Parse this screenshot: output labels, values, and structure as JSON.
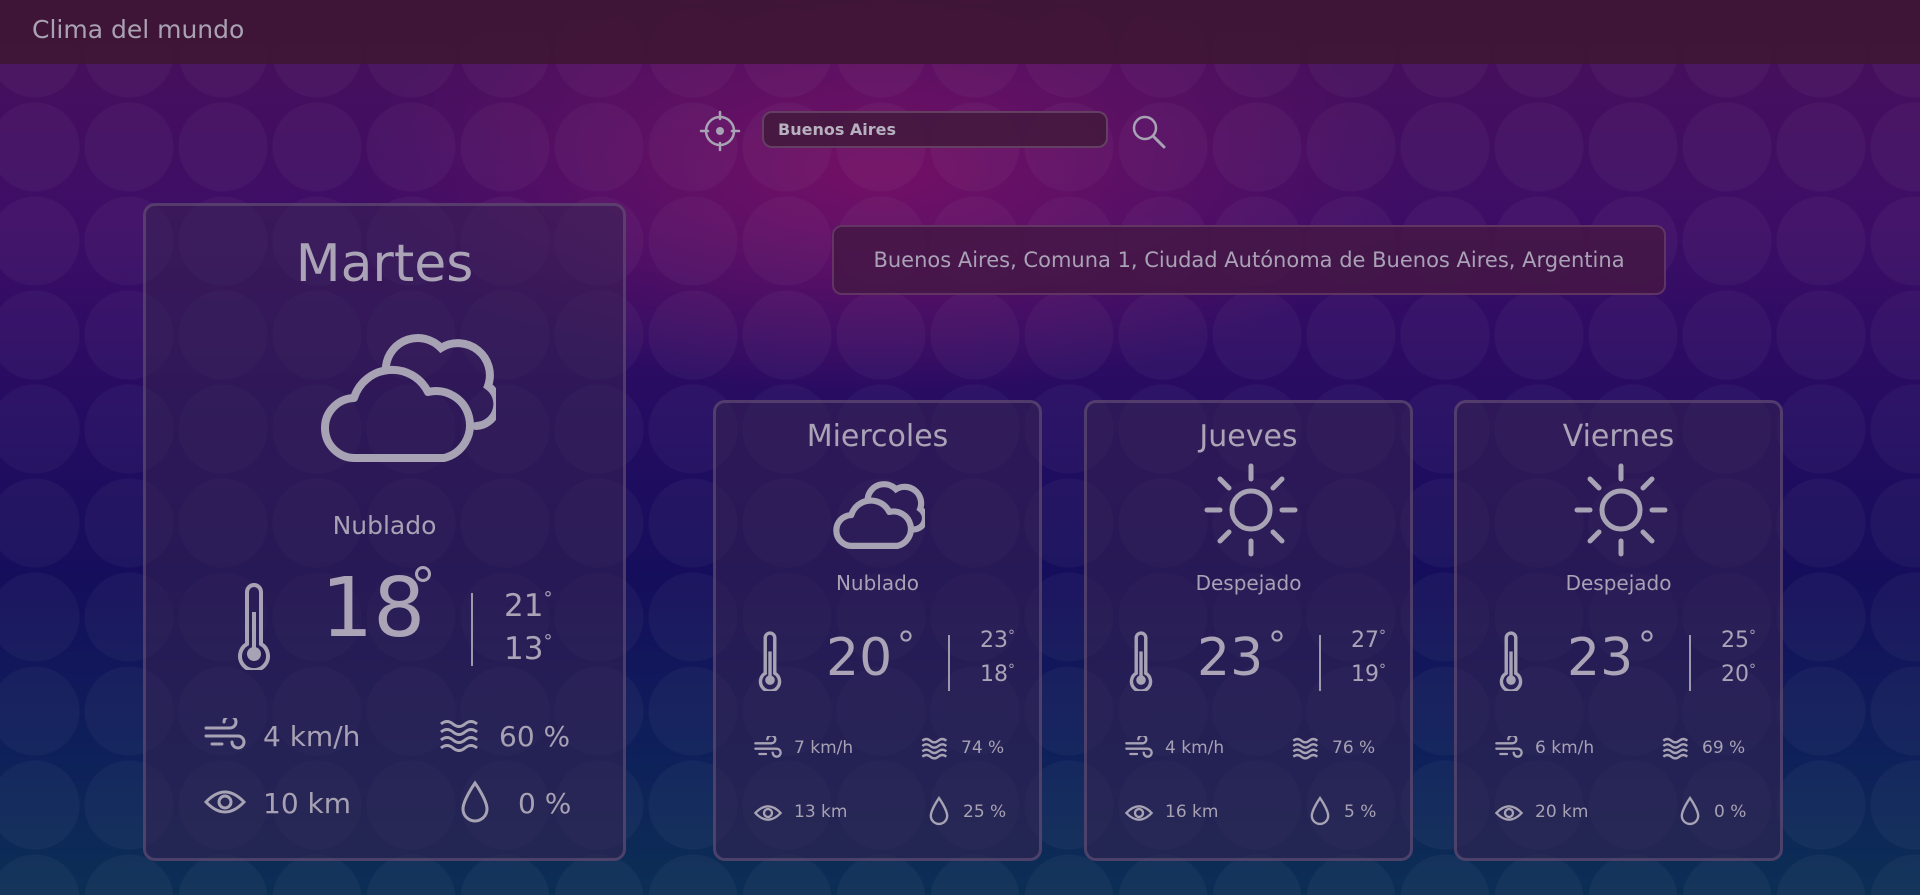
{
  "app": {
    "title": "Clima del mundo"
  },
  "search": {
    "value": "Buenos Aires",
    "placeholder": "Buenos Aires"
  },
  "location": {
    "full_name": "Buenos Aires, Comuna 1, Ciudad Autónoma de Buenos Aires, Argentina"
  },
  "colors": {
    "icon": "#a7a3b4",
    "topbar": "#3e1634",
    "accent": "#8a1a6a"
  },
  "today": {
    "day": "Martes",
    "icon": "partly-cloudy-icon",
    "condition": "Nublado",
    "temp": "18",
    "max": "21",
    "min": "13",
    "wind": "4 km/h",
    "humidity": "60 %",
    "visibility": "10 km",
    "precipitation": "0 %"
  },
  "forecast": [
    {
      "day": "Miercoles",
      "icon": "partly-cloudy-icon",
      "condition": "Nublado",
      "temp": "20",
      "max": "23",
      "min": "18",
      "wind": "7 km/h",
      "humidity": "74 %",
      "visibility": "13 km",
      "precipitation": "25 %"
    },
    {
      "day": "Jueves",
      "icon": "sun-icon",
      "condition": "Despejado",
      "temp": "23",
      "max": "27",
      "min": "19",
      "wind": "4 km/h",
      "humidity": "76 %",
      "visibility": "16 km",
      "precipitation": "5 %"
    },
    {
      "day": "Viernes",
      "icon": "sun-icon",
      "condition": "Despejado",
      "temp": "23",
      "max": "25",
      "min": "20",
      "wind": "6 km/h",
      "humidity": "69 %",
      "visibility": "20 km",
      "precipitation": "0 %"
    }
  ]
}
